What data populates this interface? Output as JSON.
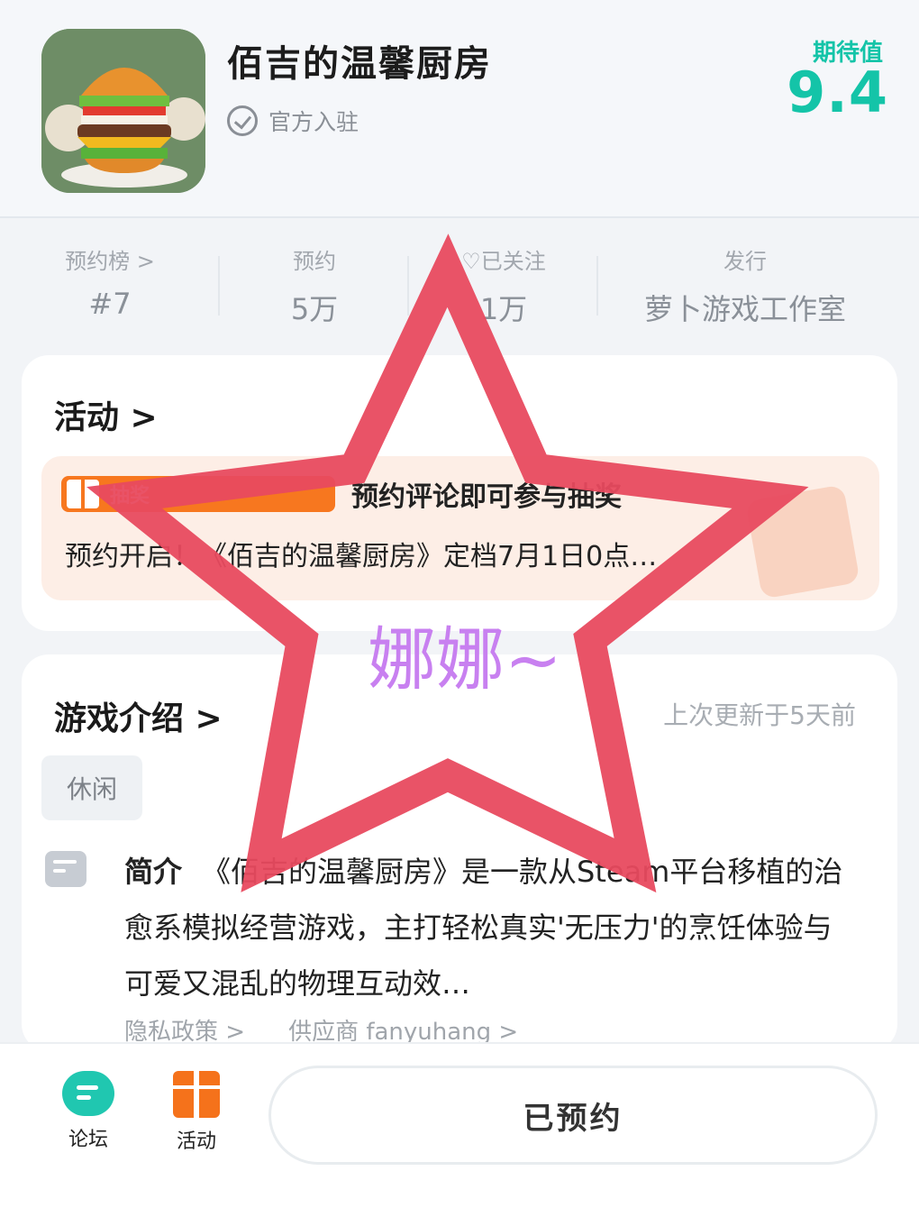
{
  "header": {
    "app_title": "佰吉的温馨厨房",
    "official_label": "官方入驻",
    "expect_label": "期待值",
    "expect_score": "9.4"
  },
  "stats": [
    {
      "label": "预约榜 >",
      "value": "#7"
    },
    {
      "label": "预约",
      "value": "5万"
    },
    {
      "label": "♡已关注",
      "value": "1万"
    },
    {
      "label": "发行",
      "value": "萝卜游戏工作室"
    }
  ],
  "activity": {
    "title": "活动 >",
    "badge": "抽奖",
    "promo_title": "预约评论即可参与抽奖",
    "promo_desc": "预约开启！《佰吉的温馨厨房》定档7月1日0点…"
  },
  "intro": {
    "title": "游戏介绍 >",
    "updated": "上次更新于5天前",
    "tag": "休闲",
    "label": "简介",
    "text": "《佰吉的温馨厨房》是一款从Steam平台移植的治愈系模拟经营游戏，主打轻松真实'无压力'的烹饪体验与可爱又混乱的物理互动效…",
    "privacy": "隐私政策 >",
    "vendor": "供应商 fanyuhang >"
  },
  "bottom": {
    "forum": "论坛",
    "activity": "活动",
    "reserve": "已预约"
  },
  "watermark": "娜娜~",
  "colors": {
    "accent": "#14c4a8",
    "orange": "#f5721b",
    "star": "#e84a5f",
    "watermark": "#c880f0"
  }
}
